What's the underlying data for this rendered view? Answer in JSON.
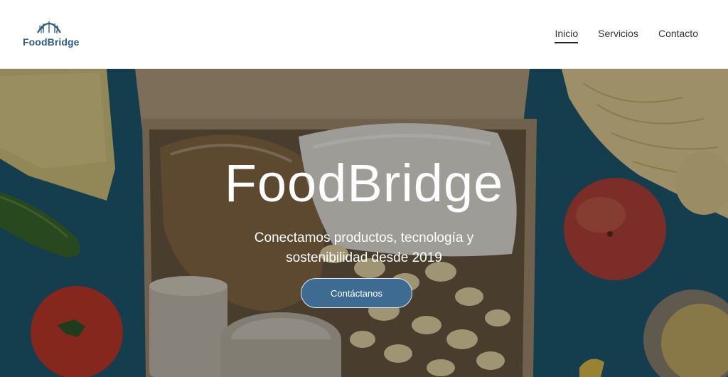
{
  "header": {
    "logo": {
      "text_part1": "Food",
      "text_part2": "Bridge"
    },
    "nav": [
      {
        "label": "Inicio",
        "active": true
      },
      {
        "label": "Servicios",
        "active": false
      },
      {
        "label": "Contacto",
        "active": false
      }
    ]
  },
  "hero": {
    "title": "FoodBridge",
    "subtitle": "Conectamos productos, tecnología y sostenibilidad desde 2019",
    "cta_label": "Contáctanos"
  },
  "colors": {
    "brand": "#2f5d86",
    "cta": "#3d6b92",
    "hero_background": "#1f5670"
  }
}
